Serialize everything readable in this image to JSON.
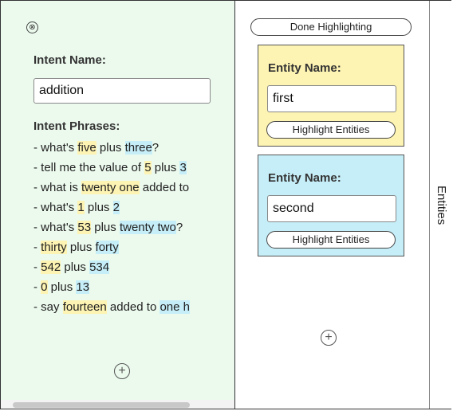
{
  "intent_panel": {
    "close_symbol": "⊗",
    "intent_name_label": "Intent Name:",
    "intent_name_value": "addition",
    "intent_phrases_label": "Intent Phrases:",
    "phrases": [
      [
        {
          "t": "- what's "
        },
        {
          "t": "five",
          "h": "y"
        },
        {
          "t": " plus "
        },
        {
          "t": "three",
          "h": "b"
        },
        {
          "t": "?"
        }
      ],
      [
        {
          "t": "- tell me the value of "
        },
        {
          "t": "5",
          "h": "y"
        },
        {
          "t": " plus "
        },
        {
          "t": "3",
          "h": "b"
        }
      ],
      [
        {
          "t": "- what is "
        },
        {
          "t": "twenty one",
          "h": "y"
        },
        {
          "t": " added to"
        }
      ],
      [
        {
          "t": "- what's "
        },
        {
          "t": "1",
          "h": "y"
        },
        {
          "t": " plus "
        },
        {
          "t": "2",
          "h": "b"
        }
      ],
      [
        {
          "t": "- what's "
        },
        {
          "t": "53",
          "h": "y"
        },
        {
          "t": " plus "
        },
        {
          "t": "twenty two",
          "h": "b"
        },
        {
          "t": "?"
        }
      ],
      [
        {
          "t": "- "
        },
        {
          "t": "thirty",
          "h": "y"
        },
        {
          "t": " plus "
        },
        {
          "t": "forty",
          "h": "b"
        }
      ],
      [
        {
          "t": "- "
        },
        {
          "t": "542",
          "h": "y"
        },
        {
          "t": " plus "
        },
        {
          "t": "534",
          "h": "b"
        }
      ],
      [
        {
          "t": "- "
        },
        {
          "t": "0",
          "h": "y"
        },
        {
          "t": " plus "
        },
        {
          "t": "13",
          "h": "b"
        }
      ],
      [
        {
          "t": "- say "
        },
        {
          "t": "fourteen",
          "h": "y"
        },
        {
          "t": " added to "
        },
        {
          "t": "one h",
          "h": "b"
        }
      ]
    ],
    "add_symbol": "+"
  },
  "entity_column": {
    "done_label": "Done Highlighting",
    "entities": [
      {
        "label": "Entity Name:",
        "value": "first",
        "button": "Highlight Entities",
        "color": "#fdf3b2"
      },
      {
        "label": "Entity Name:",
        "value": "second",
        "button": "Highlight Entities",
        "color": "#c6eef8"
      }
    ],
    "add_symbol": "+"
  },
  "tab": {
    "label": "Entities"
  },
  "colors": {
    "highlight_first": "#fdf3b2",
    "highlight_second": "#c6eef8",
    "panel_bg": "#ecfaee"
  }
}
